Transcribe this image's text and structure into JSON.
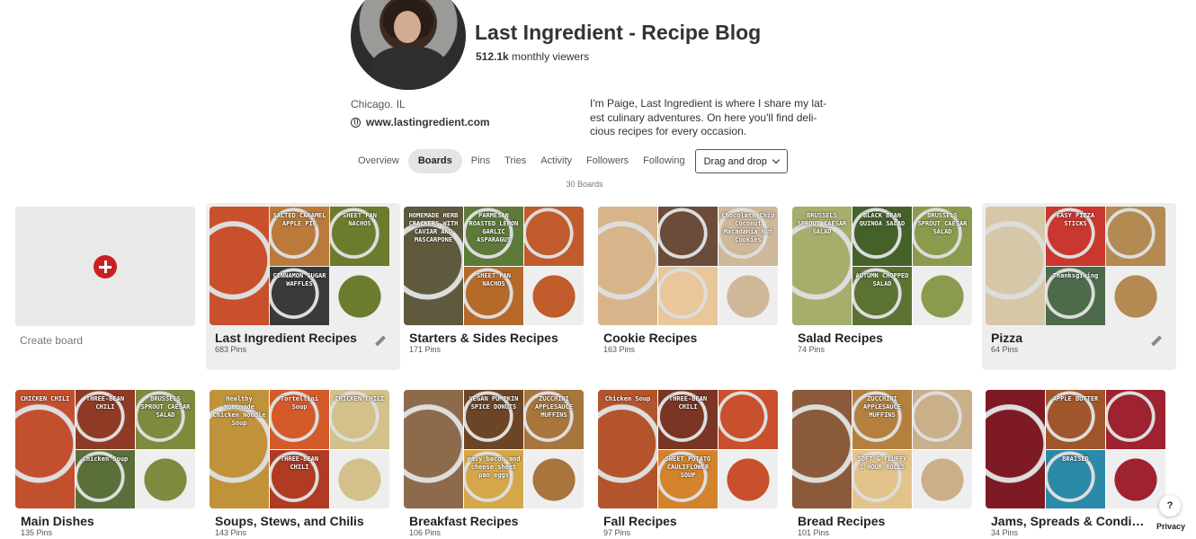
{
  "profile": {
    "name": "Last Ingredient - Recipe Blog",
    "viewers_count": "512.1k",
    "viewers_label": "monthly viewers",
    "location": "Chicago. IL",
    "website": "www.lastingredient.com",
    "bio": "I'm Paige, Last Ingredient is where I share my lat-est culinary adventures. On here you'll find deli-cious recipes for every occasion."
  },
  "tabs": [
    "Overview",
    "Boards",
    "Pins",
    "Tries",
    "Activity",
    "Followers",
    "Following"
  ],
  "active_tab": "Boards",
  "sort_dropdown": "Drag and drop",
  "boards_count": "30 Boards",
  "create_board_label": "Create board",
  "colors": {
    "accent": "#cc1f25",
    "active_tab_bg": "#e4e4e4"
  },
  "boards": [
    {
      "name": "Last Ingredient Recipes",
      "pins": "683 Pins",
      "labels": [
        "",
        "SALTED CARAMEL APPLE PIE",
        "SHEET PAN NACHOS",
        "CINNAMON SUGAR WAFFLES"
      ],
      "colors": [
        "#c8502c",
        "#b97a3a",
        "#6c7c2e",
        "#3a3a3a"
      ]
    },
    {
      "name": "Starters & Sides Recipes",
      "pins": "171 Pins",
      "labels": [
        "HOMEMADE HERB CRACKERS WITH CAVIAR AND MASCARPONE",
        "PARMESAN ROASTED LEMON GARLIC ASPARAGUS",
        "",
        "SHEET PAN NACHOS"
      ],
      "colors": [
        "#5f5a3e",
        "#5e7a3a",
        "#c05b2c",
        "#b56a2a"
      ]
    },
    {
      "name": "Cookie Recipes",
      "pins": "163 Pins",
      "labels": [
        "",
        "",
        "Chocolate Chip Coconut Macadamia Nut Cookies",
        ""
      ],
      "colors": [
        "#d8b48a",
        "#6b4b3a",
        "#cfb89a",
        "#e9c79a"
      ]
    },
    {
      "name": "Salad Recipes",
      "pins": "74 Pins",
      "labels": [
        "BRUSSELS SPROUT CAESAR SALAD",
        "BLACK BEAN QUINOA SALAD",
        "BRUSSELS SPROUT CAESAR SALAD",
        "AUTUMN CHOPPED SALAD"
      ],
      "colors": [
        "#a7ad6b",
        "#45612a",
        "#8b9b4d",
        "#5b7233"
      ]
    },
    {
      "name": "Pizza",
      "pins": "64 Pins",
      "labels": [
        "",
        "EASY PIZZA STICKS",
        "",
        "Thanksgiving"
      ],
      "colors": [
        "#d6c7a8",
        "#c9382e",
        "#b38a52",
        "#4d6b4a"
      ]
    },
    {
      "name": "Main Dishes",
      "pins": "135 Pins",
      "labels": [
        "CHICKEN CHILI",
        "THREE-BEAN CHILI",
        "BRUSSELS SPROUT CAESAR SALAD",
        "Chicken Soup"
      ],
      "colors": [
        "#c2502e",
        "#8f3a25",
        "#7d8b3e",
        "#5a6f3a"
      ]
    },
    {
      "name": "Soups, Stews, and Chilis",
      "pins": "143 Pins",
      "labels": [
        "Healthy Homemade Chicken Noodle Soup",
        "Tortellini Soup",
        "CHICKEN CHILI",
        "THREE-BEAN CHILI"
      ],
      "colors": [
        "#c0923a",
        "#d45a2a",
        "#d3c08a",
        "#b03a22"
      ]
    },
    {
      "name": "Breakfast Recipes",
      "pins": "106 Pins",
      "labels": [
        "",
        "VEGAN PUMPKIN SPICE DONUTS",
        "ZUCCHINI APPLESAUCE MUFFINS",
        "easy bacon and cheese sheet pan eggs"
      ],
      "colors": [
        "#8d6a4c",
        "#6b4526",
        "#a8753c",
        "#d4a74a"
      ]
    },
    {
      "name": "Fall Recipes",
      "pins": "97 Pins",
      "labels": [
        "Chicken Soup",
        "THREE-BEAN CHILI",
        "",
        "SWEET POTATO CAULIFLOWER SOUP"
      ],
      "colors": [
        "#b4542c",
        "#7a3524",
        "#c8502c",
        "#d2832c"
      ]
    },
    {
      "name": "Bread Recipes",
      "pins": "101 Pins",
      "labels": [
        "",
        "ZUCCHINI APPLESAUCE MUFFINS",
        "",
        "SOFT & FLUFFY 1 HOUR ROLLS"
      ],
      "colors": [
        "#8a5a3a",
        "#b5803e",
        "#c9b08a",
        "#e2c38a"
      ]
    },
    {
      "name": "Jams, Spreads & Condime...",
      "pins": "34 Pins",
      "labels": [
        "",
        "APPLE BUTTER",
        "",
        "BRAISED"
      ],
      "colors": [
        "#7d1a24",
        "#a0562a",
        "#9e2230",
        "#2a8aa8"
      ]
    }
  ],
  "help_label": "?",
  "privacy_label": "Privacy"
}
